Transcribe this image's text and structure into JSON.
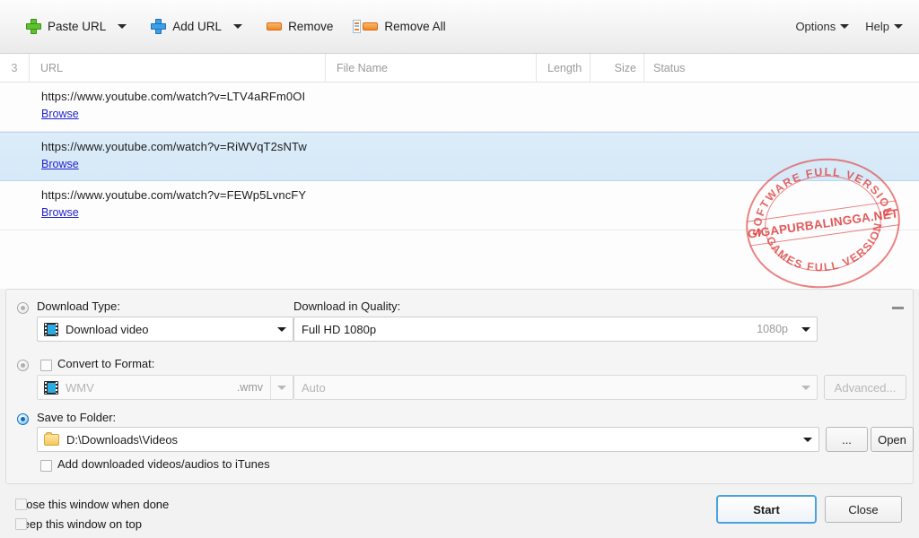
{
  "toolbar": {
    "paste_url": "Paste URL",
    "add_url": "Add URL",
    "remove": "Remove",
    "remove_all": "Remove All",
    "options": "Options",
    "help": "Help"
  },
  "list": {
    "count": "3",
    "columns": {
      "url": "URL",
      "file_name": "File Name",
      "length": "Length",
      "size": "Size",
      "status": "Status"
    },
    "browse_label": "Browse",
    "rows": [
      {
        "url": "https://www.youtube.com/watch?v=LTV4aRFm0OI",
        "browse": "Browse",
        "file_name": "",
        "length": "",
        "size": "",
        "status": "",
        "selected": false
      },
      {
        "url": "https://www.youtube.com/watch?v=RiWVqT2sNTw",
        "browse": "Browse",
        "file_name": "",
        "length": "",
        "size": "",
        "status": "",
        "selected": true
      },
      {
        "url": "https://www.youtube.com/watch?v=FEWp5LvncFY",
        "browse": "Browse",
        "file_name": "",
        "length": "",
        "size": "",
        "status": "",
        "selected": false
      }
    ]
  },
  "options_panel": {
    "download_type": {
      "label": "Download Type:",
      "value": "Download video",
      "selected": false
    },
    "download_quality": {
      "label": "Download in Quality:",
      "value": "Full HD 1080p",
      "right_value": "1080p"
    },
    "convert": {
      "label": "Convert to Format:",
      "checked": false,
      "selected": false,
      "format": "WMV",
      "extension": ".wmv",
      "preset": "Auto",
      "advanced_label": "Advanced..."
    },
    "save_folder": {
      "label": "Save to Folder:",
      "selected": true,
      "path": "D:\\Downloads\\Videos",
      "browse_btn": "...",
      "open_btn": "Open",
      "itunes_label": "Add downloaded videos/audios to iTunes",
      "itunes_checked": false
    }
  },
  "footer": {
    "close_when_done": "Close this window when done",
    "close_when_done_checked": false,
    "keep_on_top": "Keep this window on top",
    "keep_on_top_checked": false,
    "start_button": "Start",
    "close_button": "Close"
  },
  "watermark": {
    "top_arc": "SOFTWARE FULL VERSION",
    "center": "GIGAPURBALINGGA.NET",
    "bottom_arc": "GAMES FULL VERSION",
    "color": "#de3c3c"
  }
}
